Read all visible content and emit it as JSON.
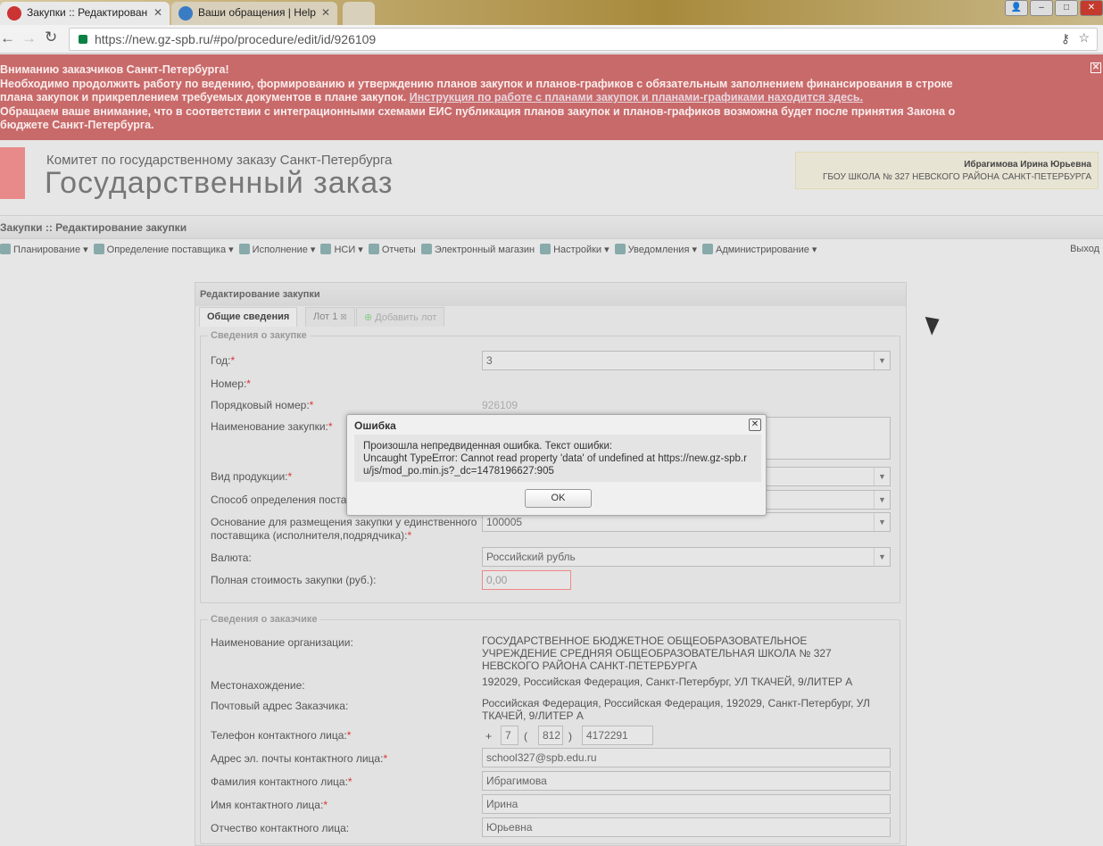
{
  "browser": {
    "tabs": [
      {
        "title": "Закупки :: Редактирован"
      },
      {
        "title": "Ваши обращения | Help"
      }
    ],
    "url": "https://new.gz-spb.ru/#po/procedure/edit/id/926109"
  },
  "banner": {
    "line1": "Вниманию заказчиков Санкт-Петербурга!",
    "line2": "Необходимо продолжить работу по ведению, формированию и утверждению планов закупок и планов-графиков с обязательным заполнением финансирования в строке",
    "line3": "плана закупок и прикреплением требуемых документов в плане закупок.",
    "link": "Инструкция по работе с планами закупок и планами-графиками находится здесь.",
    "line4": "Обращаем ваше внимание, что в соответствии с интеграционными схемами ЕИС публикация планов закупок и планов-графиков возможна будет после принятия Закона о",
    "line5": "бюджете Санкт-Петербурга."
  },
  "header": {
    "org_line": "Комитет по государственному заказу Санкт-Петербурга",
    "title": "Государственный заказ",
    "user_name": "Ибрагимова Ирина Юрьевна",
    "user_org": "ГБОУ ШКОЛА № 327 НЕВСКОГО РАЙОНА САНКТ-ПЕТЕРБУРГА"
  },
  "breadcrumb": "Закупки :: Редактирование закупки",
  "menu": [
    "Планирование ▾",
    "Определение поставщика ▾",
    "Исполнение ▾",
    "НСИ ▾",
    "Отчеты",
    "Электронный магазин",
    "Настройки ▾",
    "Уведомления ▾",
    "Администрирование ▾"
  ],
  "exit": "Выход",
  "panel": {
    "title": "Редактирование закупки",
    "tabs": [
      "Общие сведения",
      "Лот 1",
      "Добавить лот"
    ],
    "section1": {
      "legend": "Сведения о закупке",
      "year_label": "Год:",
      "year_value": "3",
      "number_label": "Номер:",
      "serial_label": "Порядковый номер:",
      "serial_value": "926109",
      "name_label": "Наименование закупки:",
      "product_label": "Вид продукции:",
      "method_label": "Способ определения поставщика",
      "basis_label1": "Основание для размещения закупки у единственного",
      "basis_label2": "поставщика (исполнителя,подрядчика):",
      "basis_value": "100005",
      "currency_label": "Валюта:",
      "currency_value": "Российский рубль",
      "cost_label": "Полная стоимость закупки (руб.):",
      "cost_value": "0,00"
    },
    "section2": {
      "legend": "Сведения о заказчике",
      "org_label": "Наименование организации:",
      "org_value": "ГОСУДАРСТВЕННОЕ БЮДЖЕТНОЕ ОБЩЕОБРАЗОВАТЕЛЬНОЕ УЧРЕЖДЕНИЕ СРЕДНЯЯ ОБЩЕОБРАЗОВАТЕЛЬНАЯ ШКОЛА № 327 НЕВСКОГО РАЙОНА САНКТ-ПЕТЕРБУРГА",
      "location_label": "Местонахождение:",
      "location_value": "192029, Российская Федерация, Санкт-Петербург, УЛ ТКАЧЕЙ, 9/ЛИТЕР А",
      "postal_label": "Почтовый адрес Заказчика:",
      "postal_value": "Российская Федерация, Российская Федерация, 192029, Санкт-Петербург, УЛ ТКАЧЕЙ, 9/ЛИТЕР А",
      "phone_label": "Телефон контактного лица:",
      "phone_plus": "+",
      "phone_country": "7",
      "phone_code": "812",
      "phone_number": "4172291",
      "email_label": "Адрес эл. почты контактного лица:",
      "email_value": "school327@spb.edu.ru",
      "surname_label": "Фамилия контактного лица:",
      "surname_value": "Ибрагимова",
      "firstname_label": "Имя контактного лица:",
      "firstname_value": "Ирина",
      "patronymic_label": "Отчество контактного лица:",
      "patronymic_value": "Юрьевна"
    }
  },
  "dialog": {
    "title": "Ошибка",
    "line1": "Произошла непредвиденная ошибка. Текст ошибки:",
    "line2": "Uncaught TypeError: Cannot read property 'data' of undefined at https://new.gz-spb.ru/js/mod_po.min.js?_dc=1478196627:905",
    "ok": "OK"
  }
}
